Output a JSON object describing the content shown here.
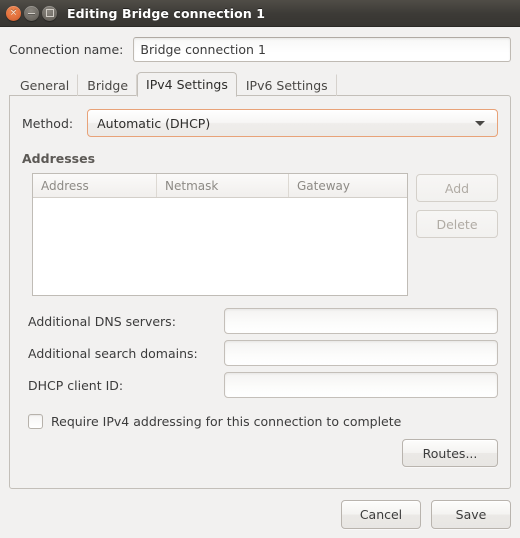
{
  "window": {
    "title": "Editing Bridge connection 1",
    "controls": [
      {
        "name": "close",
        "glyph": "×"
      },
      {
        "name": "minimize",
        "glyph": "−"
      },
      {
        "name": "maximize",
        "glyph": "□"
      }
    ]
  },
  "connection": {
    "label": "Connection name:",
    "value": "Bridge connection 1",
    "placeholder": ""
  },
  "tabs": [
    {
      "label": "General",
      "active": false
    },
    {
      "label": "Bridge",
      "active": false
    },
    {
      "label": "IPv4 Settings",
      "active": true
    },
    {
      "label": "IPv6 Settings",
      "active": false
    }
  ],
  "ipv4": {
    "method": {
      "label": "Method:",
      "value": "Automatic (DHCP)"
    },
    "addresses": {
      "title": "Addresses",
      "columns": [
        "Address",
        "Netmask",
        "Gateway"
      ],
      "rows": [],
      "add_label": "Add",
      "delete_label": "Delete",
      "add_enabled": true,
      "delete_enabled": false
    },
    "fields": [
      {
        "label": "Additional DNS servers:",
        "value": "",
        "placeholder": ""
      },
      {
        "label": "Additional search domains:",
        "value": "",
        "placeholder": ""
      },
      {
        "label": "DHCP client ID:",
        "value": "",
        "placeholder": ""
      }
    ],
    "require_checkbox": {
      "label": "Require IPv4 addressing for this connection to complete",
      "checked": false
    },
    "routes_label": "Routes..."
  },
  "footer": {
    "cancel_label": "Cancel",
    "save_label": "Save"
  },
  "colors": {
    "titlebar": "#3c3a36",
    "background": "#f2f1f0",
    "accent": "#e8a278",
    "close_button": "#e2703c"
  }
}
